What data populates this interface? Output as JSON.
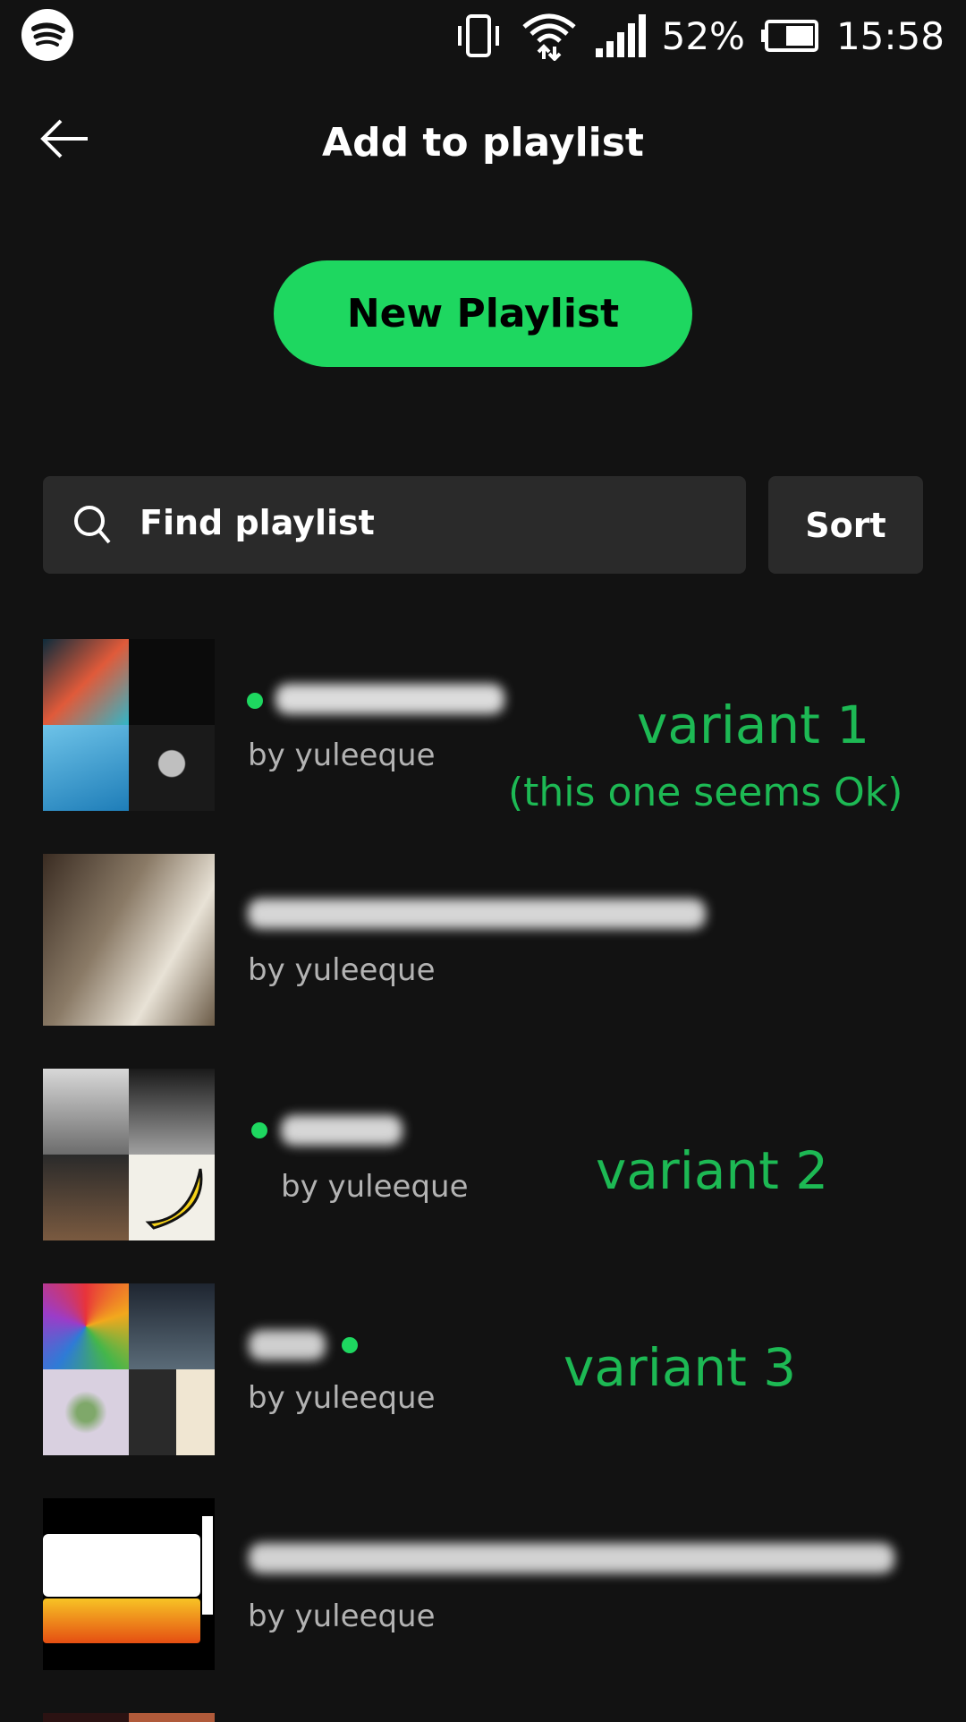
{
  "status_bar": {
    "battery": "52%",
    "time": "15:58"
  },
  "header": {
    "title": "Add to playlist"
  },
  "actions": {
    "new_playlist": "New Playlist"
  },
  "search": {
    "placeholder": "Find playlist"
  },
  "sort": {
    "label": "Sort"
  },
  "playlists": [
    {
      "owner": "by yuleeque"
    },
    {
      "owner": "by yuleeque"
    },
    {
      "owner": "by yuleeque"
    },
    {
      "owner": "by yuleeque"
    },
    {
      "owner": "by yuleeque"
    }
  ],
  "annotations": {
    "variant1": "variant 1",
    "variant1_note": "(this one seems Ok)",
    "variant2": "variant 2",
    "variant3": "variant 3"
  },
  "colors": {
    "accent": "#1ed760",
    "background": "#121212",
    "surface": "#2a2a2a"
  }
}
